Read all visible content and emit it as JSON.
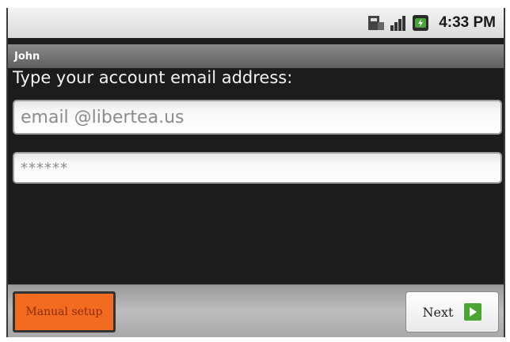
{
  "status_bar": {
    "time": "4:33 PM",
    "icons": [
      "sim-icon",
      "signal-icon",
      "battery-icon"
    ]
  },
  "header": {
    "title": "John"
  },
  "form": {
    "prompt": "Type your account email address:",
    "email_value": "email @libertea.us",
    "password_value": "******"
  },
  "buttons": {
    "manual_setup_label": "Manual setup",
    "next_label": "Next"
  },
  "colors": {
    "accent": "#f26b21",
    "next_icon": "#4aa533"
  }
}
